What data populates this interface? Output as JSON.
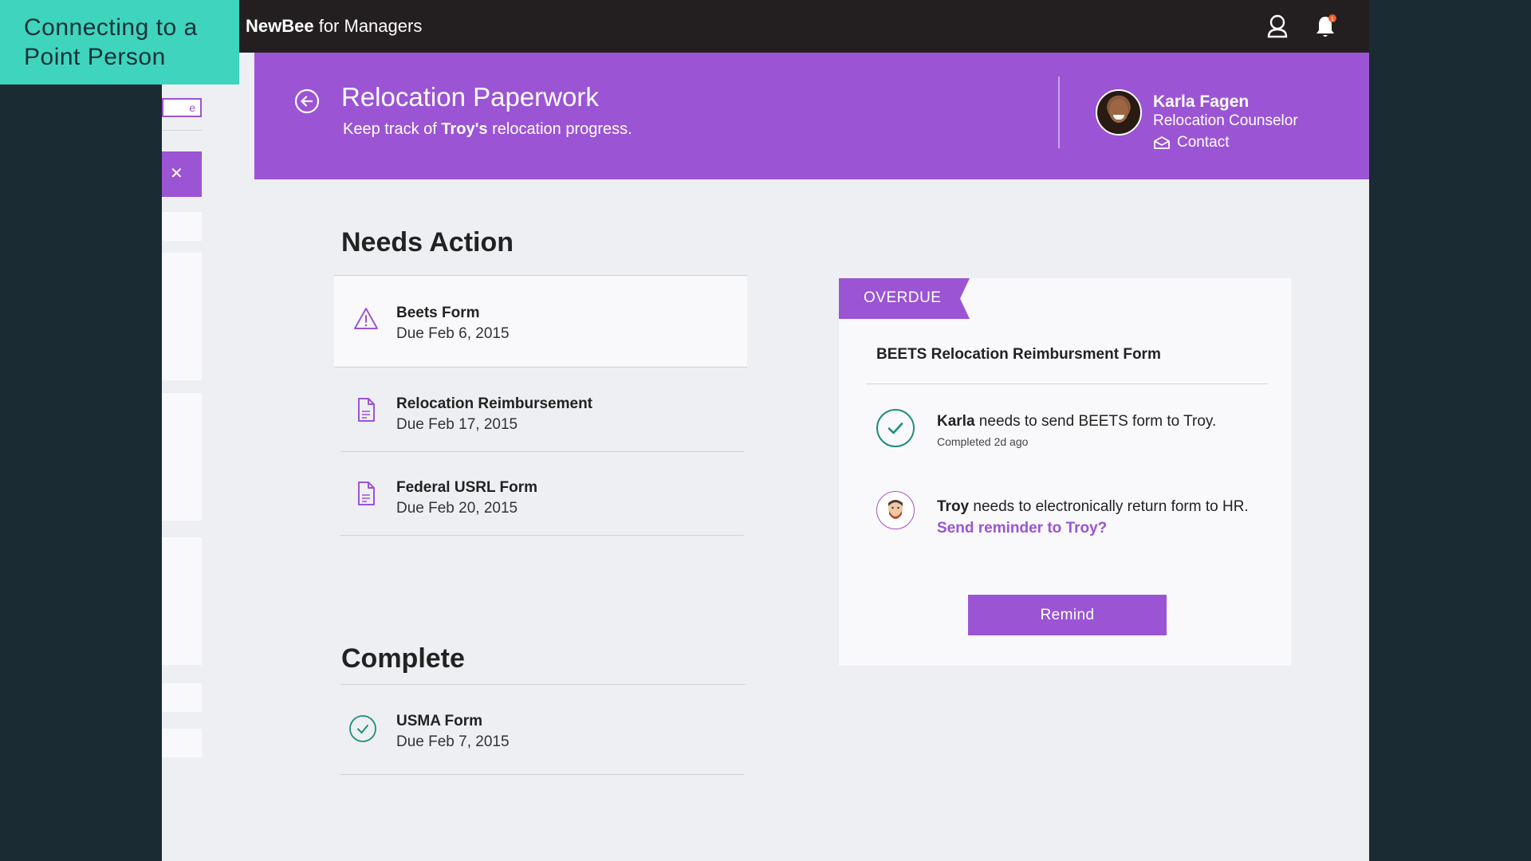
{
  "slide_label": {
    "line1": "Connecting to a",
    "line2": "Point Person"
  },
  "background_panel": {
    "input_text": "e",
    "close_glyph": "✕"
  },
  "app": {
    "brand_bold": "NewBee",
    "brand_rest": " for Managers",
    "notification_count": "1"
  },
  "header": {
    "title": "Relocation Paperwork",
    "subtitle_pre": "Keep track of ",
    "subtitle_bold": "Troy's",
    "subtitle_post": " relocation progress.",
    "point_person": {
      "name": "Karla Fagen",
      "role": "Relocation Counselor",
      "contact_label": "Contact"
    }
  },
  "needs_action": {
    "title": "Needs Action",
    "items": [
      {
        "name": "Beets Form",
        "due": "Due Feb 6, 2015",
        "icon": "warning-icon"
      },
      {
        "name": "Relocation Reimbursement",
        "due": "Due Feb 17, 2015",
        "icon": "document-icon"
      },
      {
        "name": "Federal USRL Form",
        "due": "Due Feb 20, 2015",
        "icon": "document-icon"
      }
    ]
  },
  "complete": {
    "title": "Complete",
    "items": [
      {
        "name": "USMA Form",
        "due": "Due Feb 7, 2015",
        "icon": "check-circle-icon"
      }
    ]
  },
  "detail": {
    "status_tag": "OVERDUE",
    "title": "BEETS Relocation Reimbursment Form",
    "steps": [
      {
        "actor": "Karla",
        "action": " needs to send BEETS form to Troy.",
        "sub": "Completed 2d ago"
      },
      {
        "actor": "Troy",
        "action": " needs to electronically return form to HR.",
        "link": "Send reminder to Troy?"
      }
    ],
    "remind_label": "Remind"
  },
  "colors": {
    "accent": "#9b54d4",
    "teal": "#3fd4be",
    "success": "#1c8f7a",
    "topbar": "#231f20",
    "backdrop": "#1a2b33"
  }
}
